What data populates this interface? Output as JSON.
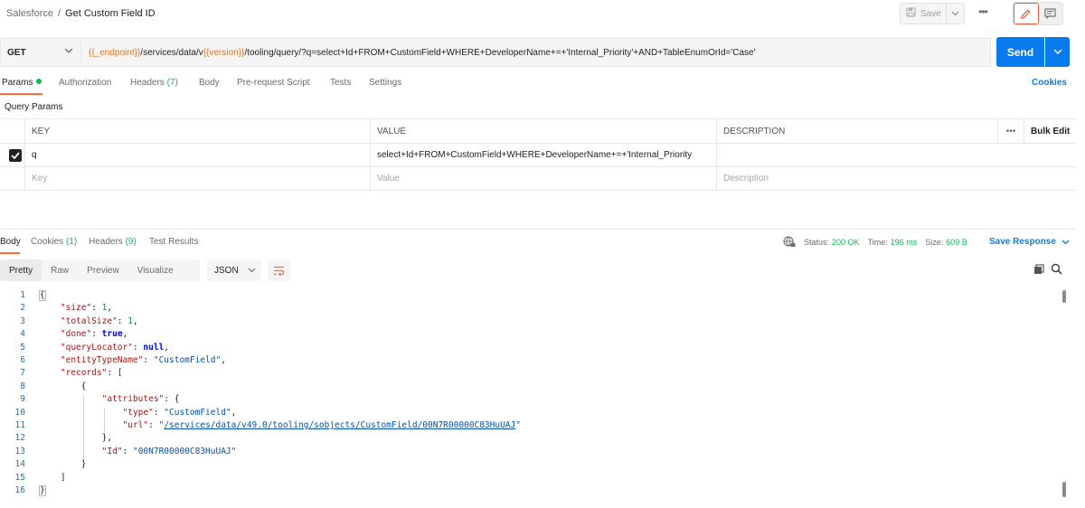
{
  "breadcrumb": {
    "collection": "Salesforce",
    "separator": "/",
    "request_name": "Get Custom Field ID"
  },
  "toolbar": {
    "save_label": "Save",
    "more": "•••"
  },
  "request": {
    "method": "GET",
    "url_parts": [
      {
        "text": "{{_endpoint}}",
        "type": "var"
      },
      {
        "text": "/services/data/v",
        "type": "plain"
      },
      {
        "text": "{{version}}",
        "type": "var"
      },
      {
        "text": "/tooling/query/?q=select+Id+FROM+CustomField+WHERE+DeveloperName+=+'Internal_Priority'+AND+TableEnumOrId='Case'",
        "type": "plain"
      }
    ],
    "send_label": "Send"
  },
  "request_tabs": {
    "params": "Params",
    "authorization": "Authorization",
    "headers": "Headers",
    "headers_count": "(7)",
    "body": "Body",
    "prerequest": "Pre-request Script",
    "tests": "Tests",
    "settings": "Settings",
    "cookies": "Cookies"
  },
  "query_params": {
    "title": "Query Params",
    "headers": {
      "key": "KEY",
      "value": "VALUE",
      "description": "DESCRIPTION",
      "more": "•••",
      "bulk_edit": "Bulk Edit"
    },
    "rows": [
      {
        "key": "q",
        "value": "select+Id+FROM+CustomField+WHERE+DeveloperName+=+'Internal_Priority",
        "description": "",
        "checked": true
      }
    ],
    "placeholders": {
      "key": "Key",
      "value": "Value",
      "description": "Description"
    }
  },
  "response_tabs": {
    "body": "Body",
    "cookies": "Cookies",
    "cookies_count": "(1)",
    "headers": "Headers",
    "headers_count": "(9)",
    "test_results": "Test Results"
  },
  "response_meta": {
    "status_label": "Status:",
    "status_value": "200 OK",
    "time_label": "Time:",
    "time_value": "196 ms",
    "size_label": "Size:",
    "size_value": "609 B",
    "save_response": "Save Response"
  },
  "view_modes": [
    "Pretty",
    "Raw",
    "Preview",
    "Visualize"
  ],
  "format": "JSON",
  "response_lines": [
    {
      "n": "1",
      "indent": 0,
      "parts": [
        [
          "p",
          "{"
        ]
      ]
    },
    {
      "n": "2",
      "indent": 4,
      "parts": [
        [
          "k",
          "\"size\""
        ],
        [
          "p",
          ": "
        ],
        [
          "n",
          "1"
        ],
        [
          "p",
          ","
        ]
      ]
    },
    {
      "n": "3",
      "indent": 4,
      "parts": [
        [
          "k",
          "\"totalSize\""
        ],
        [
          "p",
          ": "
        ],
        [
          "n",
          "1"
        ],
        [
          "p",
          ","
        ]
      ]
    },
    {
      "n": "4",
      "indent": 4,
      "parts": [
        [
          "k",
          "\"done\""
        ],
        [
          "p",
          ": "
        ],
        [
          "kw",
          "true"
        ],
        [
          "p",
          ","
        ]
      ]
    },
    {
      "n": "5",
      "indent": 4,
      "parts": [
        [
          "k",
          "\"queryLocator\""
        ],
        [
          "p",
          ": "
        ],
        [
          "kw",
          "null"
        ],
        [
          "p",
          ","
        ]
      ]
    },
    {
      "n": "6",
      "indent": 4,
      "parts": [
        [
          "k",
          "\"entityTypeName\""
        ],
        [
          "p",
          ": "
        ],
        [
          "s",
          "\"CustomField\""
        ],
        [
          "p",
          ","
        ]
      ]
    },
    {
      "n": "7",
      "indent": 4,
      "parts": [
        [
          "k",
          "\"records\""
        ],
        [
          "p",
          ": ["
        ]
      ]
    },
    {
      "n": "8",
      "indent": 8,
      "parts": [
        [
          "p",
          "{"
        ]
      ]
    },
    {
      "n": "9",
      "indent": 12,
      "parts": [
        [
          "k",
          "\"attributes\""
        ],
        [
          "p",
          ": {"
        ]
      ]
    },
    {
      "n": "10",
      "indent": 16,
      "parts": [
        [
          "k",
          "\"type\""
        ],
        [
          "p",
          ": "
        ],
        [
          "s",
          "\"CustomField\""
        ],
        [
          "p",
          ","
        ]
      ]
    },
    {
      "n": "11",
      "indent": 16,
      "parts": [
        [
          "k",
          "\"url\""
        ],
        [
          "p",
          ": "
        ],
        [
          "s",
          "\""
        ],
        [
          "u",
          "/services/data/v49.0/tooling/sobjects/CustomField/00N7R00000C83HuUAJ"
        ],
        [
          "s",
          "\""
        ]
      ]
    },
    {
      "n": "12",
      "indent": 12,
      "parts": [
        [
          "p",
          "},"
        ]
      ]
    },
    {
      "n": "13",
      "indent": 12,
      "parts": [
        [
          "k",
          "\"Id\""
        ],
        [
          "p",
          ": "
        ],
        [
          "s",
          "\"00N7R00000C83HuUAJ\""
        ]
      ]
    },
    {
      "n": "14",
      "indent": 8,
      "parts": [
        [
          "p",
          "}"
        ]
      ]
    },
    {
      "n": "15",
      "indent": 4,
      "parts": [
        [
          "p",
          "]"
        ]
      ]
    },
    {
      "n": "16",
      "indent": 0,
      "parts": [
        [
          "p",
          "}"
        ]
      ]
    }
  ],
  "colors": {
    "accent": "#ff6c37",
    "primary": "#097bed",
    "success": "#0cbb52",
    "variable": "#e8731a"
  }
}
